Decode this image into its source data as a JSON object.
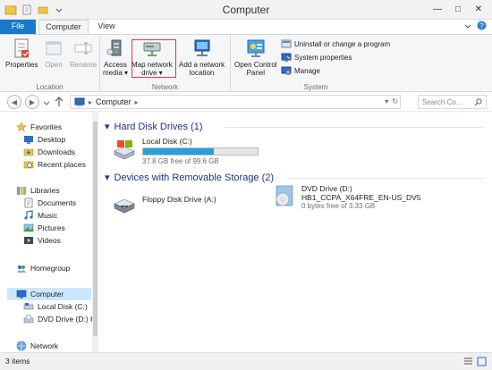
{
  "window": {
    "title": "Computer"
  },
  "ribbon_tabs": {
    "file": "File",
    "computer": "Computer",
    "view": "View"
  },
  "ribbon": {
    "location": {
      "label": "Location",
      "properties": "Properties",
      "open": "Open",
      "rename": "Rename"
    },
    "network": {
      "label": "Network",
      "access_media": [
        "Access",
        "media ▾"
      ],
      "map_network_drive": [
        "Map network",
        "drive ▾"
      ],
      "add_network_location": [
        "Add a network",
        "location"
      ]
    },
    "system": {
      "label": "System",
      "open_control_panel": [
        "Open Control",
        "Panel"
      ],
      "uninstall": "Uninstall or change a program",
      "system_properties": "System properties",
      "manage": "Manage"
    }
  },
  "address": {
    "path": "Computer",
    "search_placeholder": "Search Co..."
  },
  "nav": {
    "favorites": "Favorites",
    "desktop": "Desktop",
    "downloads": "Downloads",
    "recent_places": "Recent places",
    "libraries": "Libraries",
    "documents": "Documents",
    "music": "Music",
    "pictures": "Pictures",
    "videos": "Videos",
    "homegroup": "Homegroup",
    "computer": "Computer",
    "local_disk": "Local Disk (C:)",
    "dvd_drive": "DVD Drive (D:) HI",
    "network": "Network"
  },
  "content": {
    "hdd_header": "Hard Disk Drives (1)",
    "removable_header": "Devices with Removable Storage (2)",
    "local_disk": {
      "name": "Local Disk (C:)",
      "free": "37.8 GB free of 99.6 GB",
      "used_fraction": 0.62
    },
    "floppy": {
      "name": "Floppy Disk Drive (A:)"
    },
    "dvd": {
      "name": "DVD Drive (D:)",
      "label": "HB1_CCPA_X64FRE_EN-US_DV5",
      "free": "0 bytes free of 3.33 GB"
    }
  },
  "status": {
    "items": "3 items"
  },
  "colors": {
    "accent": "#1979ca",
    "highlight_box": "#e23b3b",
    "disk_fill": "#26a0da"
  }
}
